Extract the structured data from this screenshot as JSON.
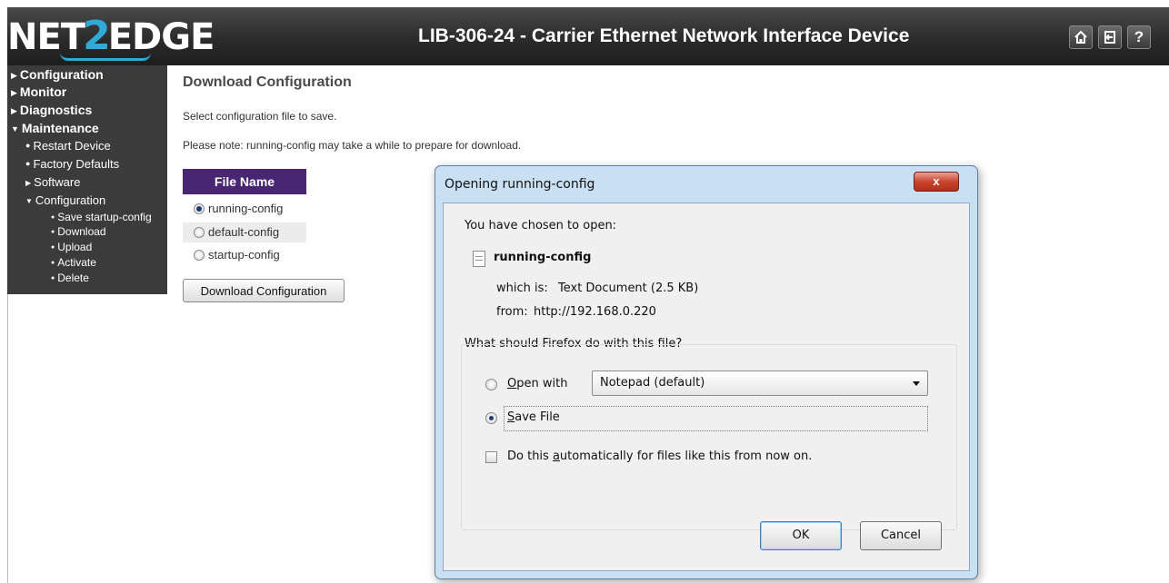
{
  "header": {
    "logo_part1": "NET",
    "logo_part2": "2",
    "logo_part3": "EDGE",
    "device_title": "LIB-306-24 - Carrier Ethernet Network Interface Device",
    "help_label": "?"
  },
  "sidebar": {
    "items": [
      {
        "label": "Configuration",
        "expanded": false
      },
      {
        "label": "Monitor",
        "expanded": false
      },
      {
        "label": "Diagnostics",
        "expanded": false
      },
      {
        "label": "Maintenance",
        "expanded": true
      }
    ],
    "maintenance_items": [
      {
        "label": "Restart Device"
      },
      {
        "label": "Factory Defaults"
      },
      {
        "label": "Software",
        "expanded": false
      },
      {
        "label": "Configuration",
        "expanded": true
      }
    ],
    "configuration_items": [
      {
        "label": "Save startup-config"
      },
      {
        "label": "Download"
      },
      {
        "label": "Upload"
      },
      {
        "label": "Activate"
      },
      {
        "label": "Delete"
      }
    ]
  },
  "main": {
    "title": "Download Configuration",
    "instruction": "Select configuration file to save.",
    "note": "Please note: running-config may take a while to prepare for download.",
    "file_table_header": "File Name",
    "files": [
      {
        "label": "running-config",
        "selected": true
      },
      {
        "label": "default-config",
        "selected": false
      },
      {
        "label": "startup-config",
        "selected": false
      }
    ],
    "download_button": "Download Configuration"
  },
  "dialog": {
    "title": "Opening running-config",
    "close_label": "x",
    "intro": "You have chosen to open:",
    "filename": "running-config",
    "which_is_label": "which is:",
    "which_is_value": "Text Document (2.5 KB)",
    "from_label": "from:",
    "from_value": "http://192.168.0.220",
    "question": "What should Firefox do with this file?",
    "open_with_accesskey": "O",
    "open_with_rest": "pen with",
    "open_with_selected": false,
    "open_with_app": "Notepad (default)",
    "save_file_accesskey": "S",
    "save_file_rest": "ave File",
    "save_file_selected": true,
    "auto_before": "Do this ",
    "auto_accesskey": "a",
    "auto_after": "utomatically for files like this from now on.",
    "auto_checked": false,
    "ok_label": "OK",
    "cancel_label": "Cancel"
  }
}
